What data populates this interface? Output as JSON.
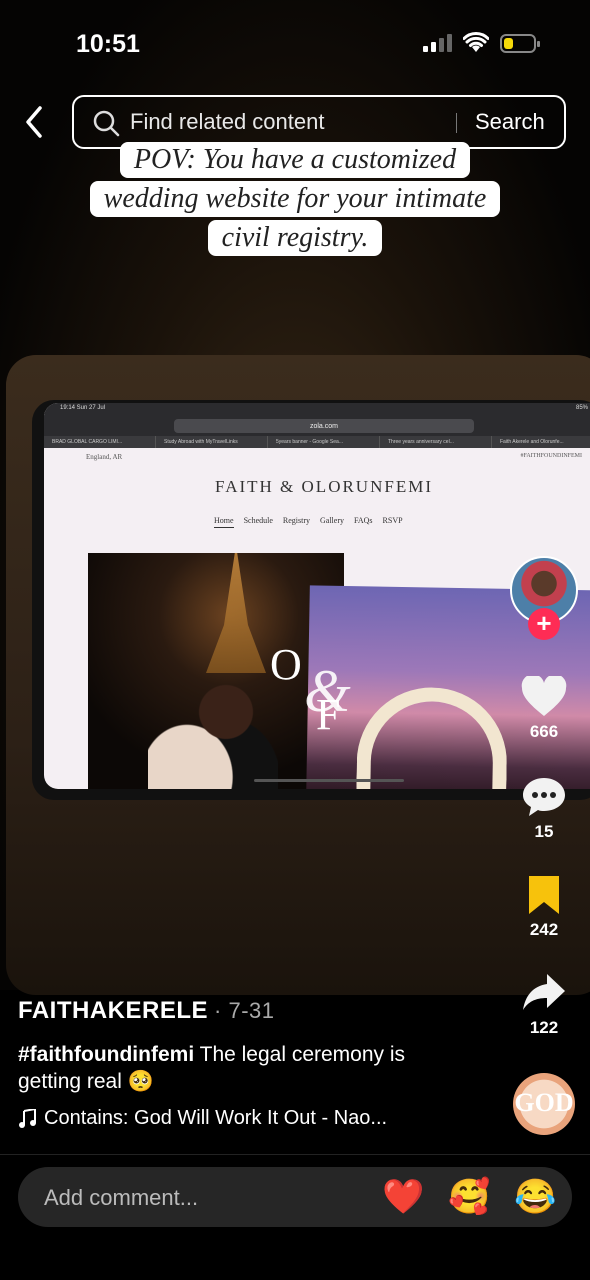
{
  "status_bar": {
    "time": "10:51"
  },
  "search": {
    "placeholder": "Find related content",
    "button": "Search"
  },
  "caption": {
    "line1": "POV: You have a customized",
    "line2": "wedding website for your intimate",
    "line3": "civil registry."
  },
  "video_screen": {
    "ipad_time": "19:14  Sun 27 Jul",
    "ipad_battery": "85%",
    "url": "zola.com",
    "tabs": [
      "BRAD GLOBAL CARGO LIMI...",
      "Study Abroad with MyTravelLinks",
      "5years banner - Google Sea...",
      "Three years anniversary cel...",
      "Faith Akerele and Olorunfe..."
    ],
    "location": "England, AR",
    "hashtag": "#FAITHFOUNDINFEMI",
    "site_title": "FAITH & OLORUNFEMI",
    "nav": [
      "Home",
      "Schedule",
      "Registry",
      "Gallery",
      "FAQs",
      "RSVP"
    ],
    "monogram_o": "O",
    "monogram_f": "F",
    "monogram_amp": "&"
  },
  "actions": {
    "likes": "666",
    "comments": "15",
    "saves": "242",
    "shares": "122"
  },
  "post": {
    "username": "FAITHAKERELE",
    "date": "· 7-31",
    "hashtag": "#faithfoundinfemi",
    "text": " The legal ceremony is getting real 🥺",
    "music": "Contains: God Will Work It Out - Nao..."
  },
  "disc_label": "GOD",
  "comment_bar": {
    "placeholder": "Add comment...",
    "emojis": [
      "❤️",
      "🥰",
      "😂"
    ]
  },
  "colors": {
    "accent_red": "#fe2c55",
    "save_yellow": "#f7c20c",
    "battery_yellow": "#f5d90a"
  }
}
